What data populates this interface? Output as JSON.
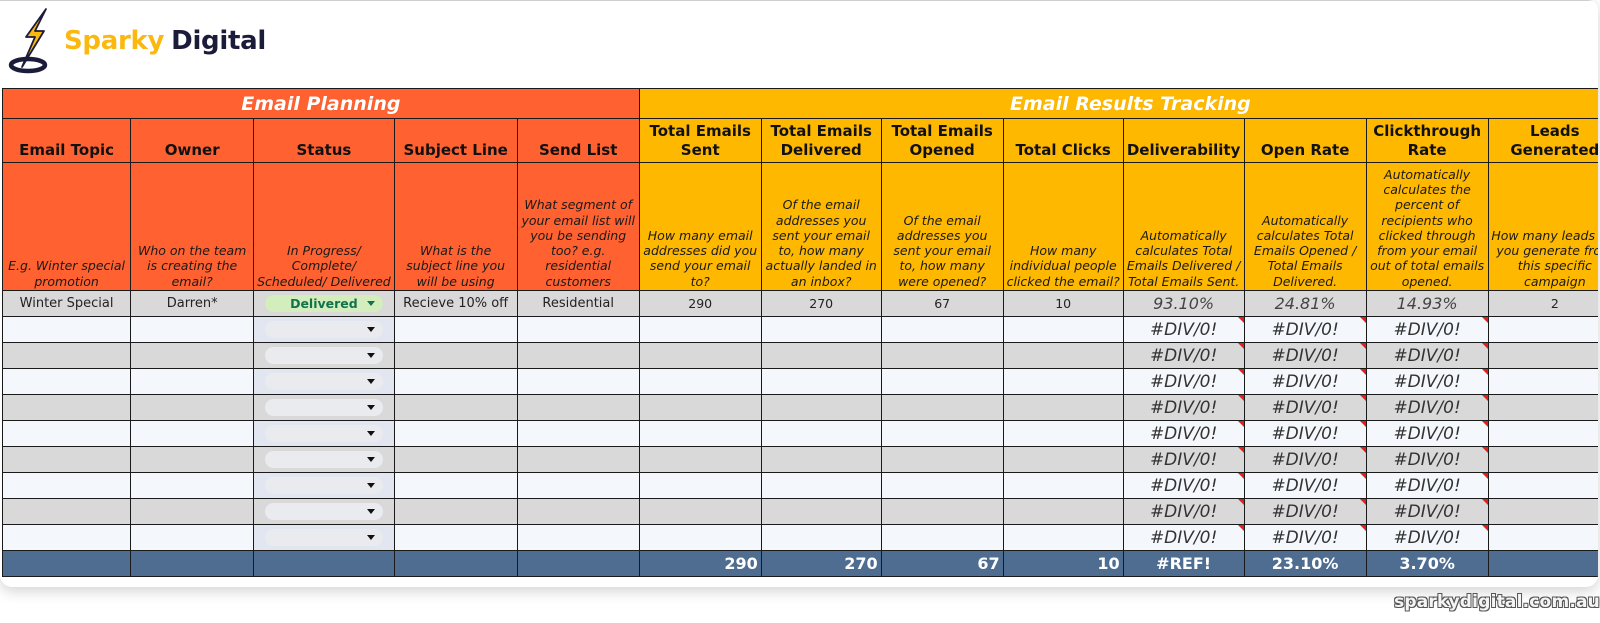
{
  "brand": {
    "name_part1": "Sparky",
    "name_part2": "Digital",
    "logo_icon": "lightning-bolt-icon",
    "colors": {
      "primary": "#fbb80f",
      "dark": "#1b1b3a"
    }
  },
  "sections": {
    "planning_title": "Email Planning",
    "tracking_title": "Email Results Tracking",
    "planning_color": "#ff6130",
    "tracking_color": "#ffb800"
  },
  "columns": [
    {
      "key": "topic",
      "header": "Email Topic",
      "description": "E.g. Winter special promotion"
    },
    {
      "key": "owner",
      "header": "Owner",
      "description": "Who on the team is creating the email?"
    },
    {
      "key": "status",
      "header": "Status",
      "description": "In Progress/ Complete/ Scheduled/ Delivered"
    },
    {
      "key": "subject",
      "header": "Subject Line",
      "description": "What is the subject line you will be using"
    },
    {
      "key": "send_list",
      "header": "Send List",
      "description": "What segment of your email list will you be sending too? e.g. residential customers"
    },
    {
      "key": "sent",
      "header": "Total Emails Sent",
      "description": "How many email addresses did you send your email to?"
    },
    {
      "key": "delivered",
      "header": "Total Emails Delivered",
      "description": "Of the email addresses you sent your email to, how many actually landed in an inbox?"
    },
    {
      "key": "opened",
      "header": "Total Emails Opened",
      "description": "Of the email addresses you sent your email to, how many were opened?"
    },
    {
      "key": "clicks",
      "header": "Total Clicks",
      "description": "How many individual people clicked the email?"
    },
    {
      "key": "deliverability",
      "header": "Deliverability",
      "description": "Automatically calculates Total Emails Delivered / Total Emails Sent."
    },
    {
      "key": "open_rate",
      "header": "Open Rate",
      "description": "Automatically calculates Total Emails Opened / Total Emails Delivered."
    },
    {
      "key": "ctr",
      "header": "Clickthrough Rate",
      "description": "Automatically calculates the percent of recipients who clicked through from your email out of total emails opened."
    },
    {
      "key": "leads",
      "header": "Leads Generated",
      "description": "How many leads did you generate from this specific campaign"
    }
  ],
  "rows": [
    {
      "topic": "Winter Special",
      "owner": "Darren*",
      "status": "Delivered",
      "subject": "Recieve 10% off",
      "send_list": "Residential",
      "sent": "290",
      "delivered": "270",
      "opened": "67",
      "clicks": "10",
      "deliverability": "93.10%",
      "open_rate": "24.81%",
      "ctr": "14.93%",
      "leads": "2"
    },
    {
      "topic": "",
      "owner": "",
      "status": "",
      "subject": "",
      "send_list": "",
      "sent": "",
      "delivered": "",
      "opened": "",
      "clicks": "",
      "deliverability": "#DIV/0!",
      "open_rate": "#DIV/0!",
      "ctr": "#DIV/0!",
      "leads": ""
    },
    {
      "topic": "",
      "owner": "",
      "status": "",
      "subject": "",
      "send_list": "",
      "sent": "",
      "delivered": "",
      "opened": "",
      "clicks": "",
      "deliverability": "#DIV/0!",
      "open_rate": "#DIV/0!",
      "ctr": "#DIV/0!",
      "leads": ""
    },
    {
      "topic": "",
      "owner": "",
      "status": "",
      "subject": "",
      "send_list": "",
      "sent": "",
      "delivered": "",
      "opened": "",
      "clicks": "",
      "deliverability": "#DIV/0!",
      "open_rate": "#DIV/0!",
      "ctr": "#DIV/0!",
      "leads": ""
    },
    {
      "topic": "",
      "owner": "",
      "status": "",
      "subject": "",
      "send_list": "",
      "sent": "",
      "delivered": "",
      "opened": "",
      "clicks": "",
      "deliverability": "#DIV/0!",
      "open_rate": "#DIV/0!",
      "ctr": "#DIV/0!",
      "leads": ""
    },
    {
      "topic": "",
      "owner": "",
      "status": "",
      "subject": "",
      "send_list": "",
      "sent": "",
      "delivered": "",
      "opened": "",
      "clicks": "",
      "deliverability": "#DIV/0!",
      "open_rate": "#DIV/0!",
      "ctr": "#DIV/0!",
      "leads": ""
    },
    {
      "topic": "",
      "owner": "",
      "status": "",
      "subject": "",
      "send_list": "",
      "sent": "",
      "delivered": "",
      "opened": "",
      "clicks": "",
      "deliverability": "#DIV/0!",
      "open_rate": "#DIV/0!",
      "ctr": "#DIV/0!",
      "leads": ""
    },
    {
      "topic": "",
      "owner": "",
      "status": "",
      "subject": "",
      "send_list": "",
      "sent": "",
      "delivered": "",
      "opened": "",
      "clicks": "",
      "deliverability": "#DIV/0!",
      "open_rate": "#DIV/0!",
      "ctr": "#DIV/0!",
      "leads": ""
    },
    {
      "topic": "",
      "owner": "",
      "status": "",
      "subject": "",
      "send_list": "",
      "sent": "",
      "delivered": "",
      "opened": "",
      "clicks": "",
      "deliverability": "#DIV/0!",
      "open_rate": "#DIV/0!",
      "ctr": "#DIV/0!",
      "leads": ""
    },
    {
      "topic": "",
      "owner": "",
      "status": "",
      "subject": "",
      "send_list": "",
      "sent": "",
      "delivered": "",
      "opened": "",
      "clicks": "",
      "deliverability": "#DIV/0!",
      "open_rate": "#DIV/0!",
      "ctr": "#DIV/0!",
      "leads": ""
    }
  ],
  "totals": {
    "topic": "",
    "owner": "",
    "status": "",
    "subject": "",
    "send_list": "",
    "sent": "290",
    "delivered": "270",
    "opened": "67",
    "clicks": "10",
    "deliverability": "#REF!",
    "open_rate": "23.10%",
    "ctr": "3.70%",
    "leads": ""
  },
  "status_options_visible": [
    "Delivered"
  ],
  "status_colors": {
    "delivered_bg": "#d4edbc",
    "delivered_text": "#11734b"
  },
  "footer": {
    "watermark": "sparkydigital.com.au"
  }
}
